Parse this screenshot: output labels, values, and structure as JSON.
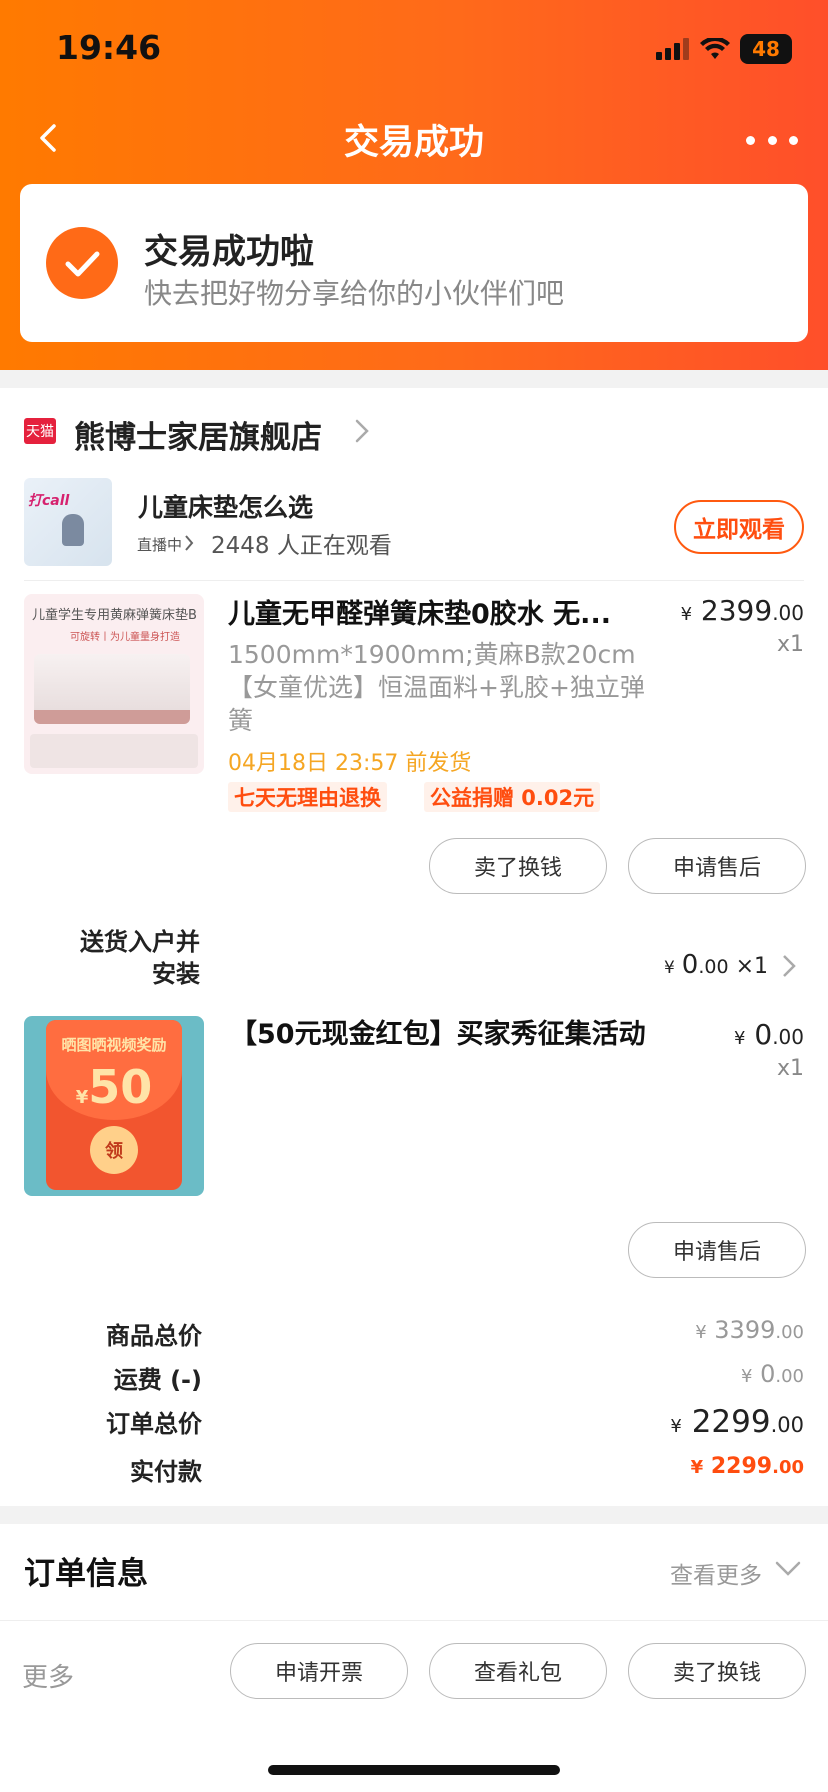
{
  "status_bar": {
    "time": "19:46",
    "battery": "48"
  },
  "header": {
    "title": "交易成功"
  },
  "success": {
    "title": "交易成功啦",
    "subtitle": "快去把好物分享给你的小伙伴们吧"
  },
  "store": {
    "badge": "天猫",
    "name": "熊博士家居旗舰店"
  },
  "live": {
    "thumb_tag": "打call",
    "title": "儿童床垫怎么选",
    "status": "直播中",
    "viewers": "2448 人正在观看",
    "watch_label": "立即观看"
  },
  "product": {
    "image_caption": "儿童学生专用黄麻弹簧床垫B",
    "image_subcaption": "可旋转丨为儿童量身打造",
    "title": "儿童无甲醛弹簧床垫0胶水 无...",
    "spec": "1500mm*1900mm;黄麻B款20cm【女童优选】恒温面料+乳胶+独立弹簧",
    "ship": "04月18日 23:57 前发货",
    "tags": [
      "七天无理由退换",
      "公益捐赠 0.02元"
    ],
    "price_int": "2399",
    "price_dec": ".00",
    "qty": "x1",
    "buttons": {
      "sell": "卖了换钱",
      "after_sale": "申请售后"
    }
  },
  "service": {
    "label": "送货入户并安装",
    "price_int": "0",
    "price_dec": ".00",
    "qty": "×1"
  },
  "red_packet": {
    "image_line1": "晒图晒视频奖励",
    "image_amount": "50",
    "image_coin": "领",
    "title": "【50元现金红包】买家秀征集活动",
    "price_int": "0",
    "price_dec": ".00",
    "qty": "x1",
    "after_sale": "申请售后"
  },
  "summary": {
    "goods_total_label": "商品总价",
    "goods_total_int": "3399",
    "goods_total_dec": ".00",
    "shipping_label": "运费 (-)",
    "shipping_int": "0",
    "shipping_dec": ".00",
    "order_total_label": "订单总价",
    "order_total_int": "2299",
    "order_total_dec": ".00",
    "paid_label": "实付款",
    "paid_int": "2299",
    "paid_dec": ".00",
    "currency": "¥"
  },
  "order_info": {
    "title": "订单信息",
    "more": "查看更多"
  },
  "bottom": {
    "more": "更多",
    "invoice": "申请开票",
    "gift": "查看礼包",
    "sell": "卖了换钱"
  },
  "colors": {
    "accent": "#ff5a10",
    "header_start": "#ff7a00",
    "header_end": "#ff4f2a",
    "ship": "#f5a623"
  }
}
